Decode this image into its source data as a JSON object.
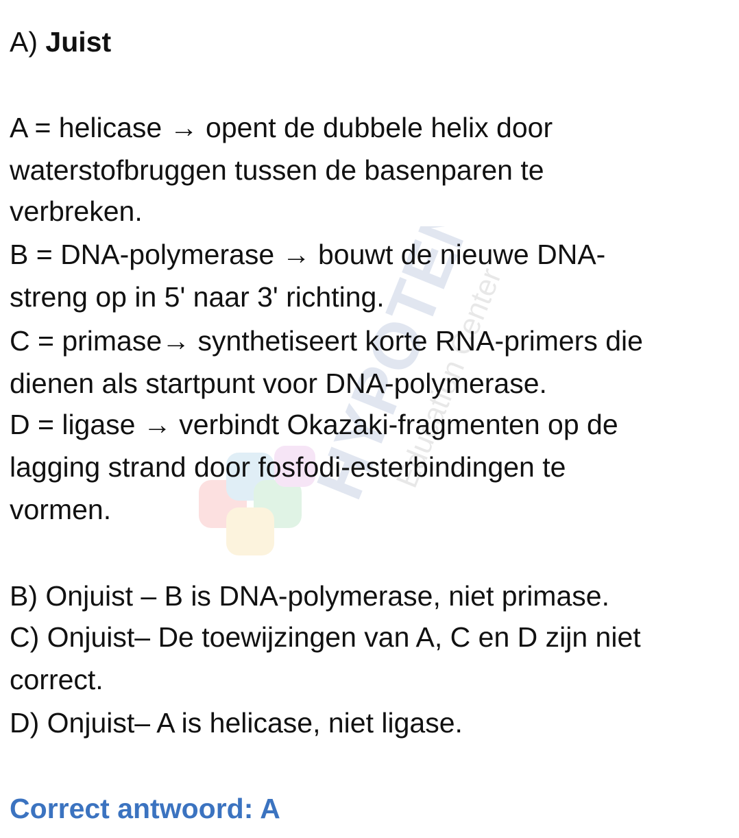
{
  "heading": {
    "prefix": "A) ",
    "verdict": "Juist"
  },
  "explanation_lines": [
    "A = helicase → opent de dubbele helix door",
    "waterstofbruggen tussen de basenparen te",
    "verbreken.",
    "B = DNA-polymerase → bouwt de nieuwe DNA-",
    "streng op in 5' naar 3' richting.",
    "C = primase→ synthetiseert korte RNA-primers die",
    "dienen als startpunt voor DNA-polymerase.",
    "D = ligase → verbindt Okazaki-fragmenten op de",
    "lagging strand door fosfodi-esterbindingen te",
    "vormen."
  ],
  "other_options_lines": [
    "B) Onjuist – B is DNA-polymerase, niet primase.",
    "C) Onjuist– De toewijzingen van A, C en D zijn niet",
    "correct.",
    "D) Onjuist– A is helicase, niet ligase."
  ],
  "correct_answer": "Correct antwoord: A",
  "watermark": {
    "brand": "HYPOTENUSE",
    "tagline": "Education Center"
  },
  "colors": {
    "answer_blue": "#3b73c0",
    "text": "#111111"
  }
}
